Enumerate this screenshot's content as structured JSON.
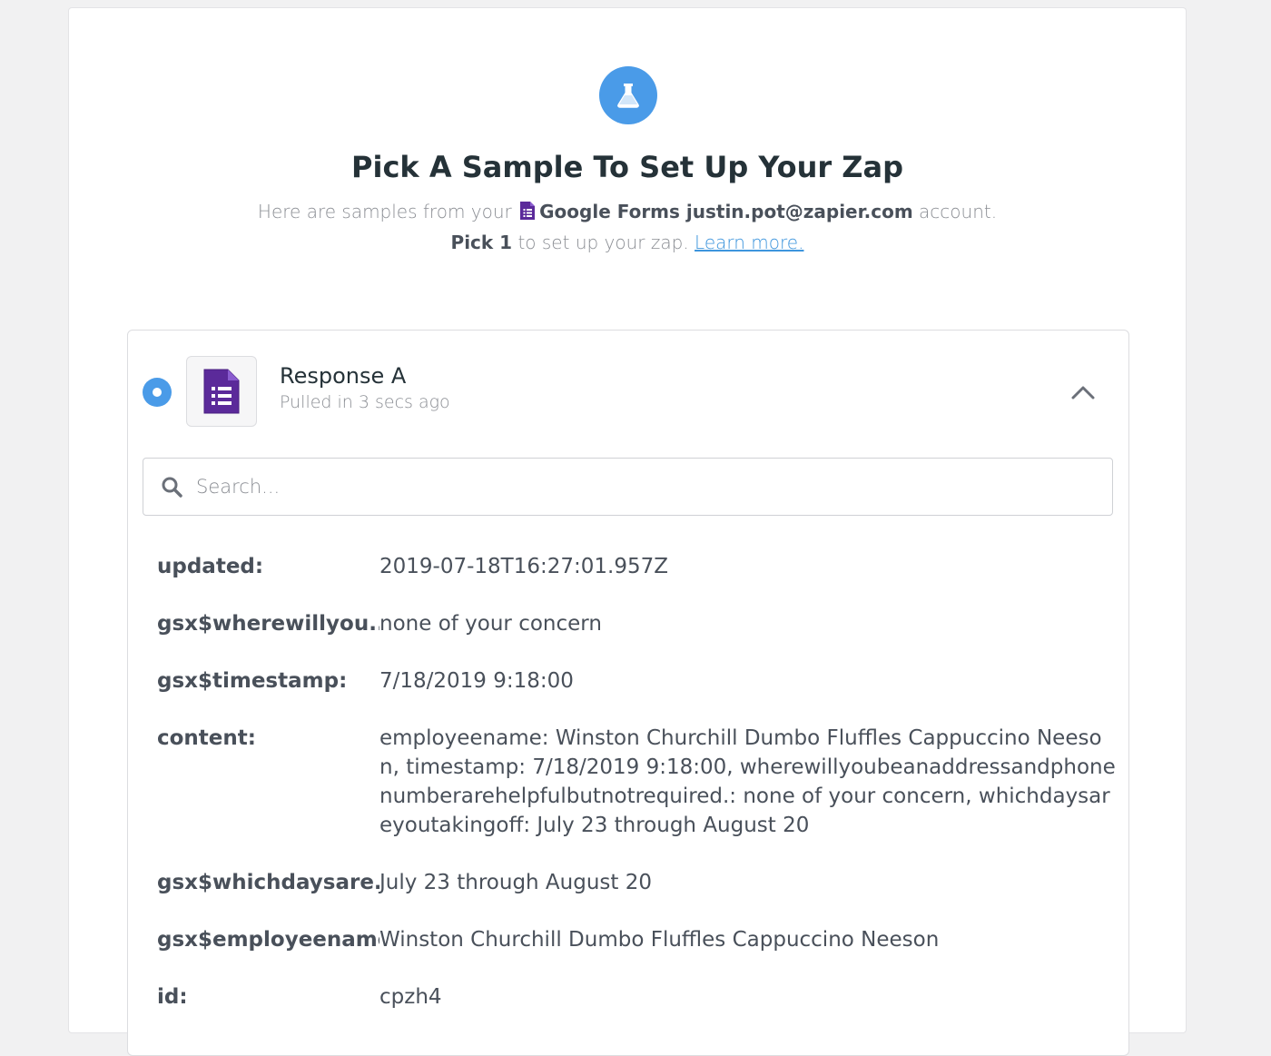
{
  "header": {
    "icon": "flask-icon",
    "title": "Pick A Sample To Set Up Your Zap",
    "sub1_pre": "Here are samples from your",
    "app_name": "Google Forms justin.pot@zapier.com",
    "sub1_post": "account.",
    "sub2_bold": "Pick 1",
    "sub2_text": "to set up your zap.",
    "learn_more": "Learn more."
  },
  "colors": {
    "accent": "#4a9be8",
    "forms_purple": "#5b2a9a",
    "link": "#3d95dd"
  },
  "sample": {
    "name": "Response A",
    "meta": "Pulled in 3 secs ago",
    "selected": true,
    "expanded": true
  },
  "search": {
    "placeholder": "Search..."
  },
  "fields": [
    {
      "key": "updated:",
      "value": "2019-07-18T16:27:01.957Z"
    },
    {
      "key": "gsx$wherewillyou...",
      "value": "none of your concern"
    },
    {
      "key": "gsx$timestamp:",
      "value": "7/18/2019 9:18:00"
    },
    {
      "key": "content:",
      "value": "employeename: Winston Churchill Dumbo Fluffles Cappuccino Neeson, timestamp: 7/18/2019 9:18:00, wherewillyoubeanaddressandphonenumberarehelpfulbutnotrequired.: none of your concern, whichdaysareyoutakingoff: July 23 through August 20"
    },
    {
      "key": "gsx$whichdaysare...",
      "value": "July 23 through August 20"
    },
    {
      "key": "gsx$employeename:",
      "value": "Winston Churchill Dumbo Fluffles Cappuccino Neeson"
    },
    {
      "key": "id:",
      "value": "cpzh4"
    }
  ]
}
